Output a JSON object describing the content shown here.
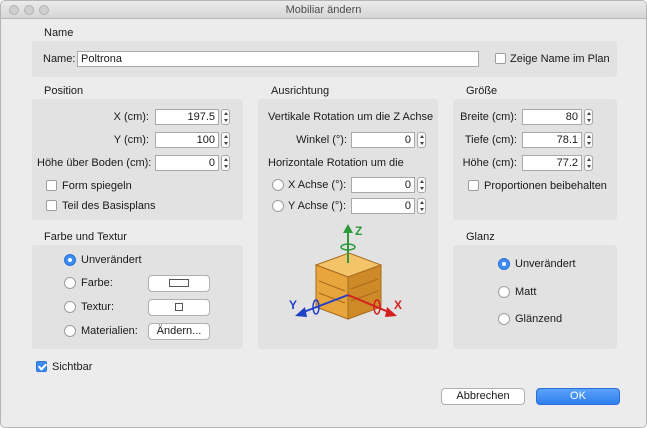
{
  "window": {
    "title": "Mobiliar ändern"
  },
  "name_section": {
    "title": "Name",
    "label": "Name:",
    "value": "Poltrona",
    "show_name_label": "Zeige Name im Plan",
    "show_name_checked": false
  },
  "position": {
    "title": "Position",
    "x_label": "X (cm):",
    "x_value": "197.5",
    "y_label": "Y (cm):",
    "y_value": "100",
    "elevation_label": "Höhe über Boden (cm):",
    "elevation_value": "0",
    "mirror_label": "Teil des Basisplans",
    "mirror_form_label": "Form spiegeln"
  },
  "orientation": {
    "title": "Ausrichtung",
    "vertical_label": "Vertikale Rotation um die Z Achse",
    "angle_label": "Winkel (°):",
    "angle_value": "0",
    "horizontal_label": "Horizontale Rotation um die",
    "x_axis_label": "X Achse (°):",
    "x_axis_value": "0",
    "y_axis_label": "Y Achse (°):",
    "y_axis_value": "0",
    "axis_letters": {
      "z": "Z",
      "x": "X",
      "y": "Y"
    }
  },
  "size": {
    "title": "Größe",
    "width_label": "Breite (cm):",
    "width_value": "80",
    "depth_label": "Tiefe (cm):",
    "depth_value": "78.1",
    "height_label": "Höhe (cm):",
    "height_value": "77.2",
    "keep_proportions_label": "Proportionen beibehalten"
  },
  "color": {
    "title": "Farbe und Textur",
    "unchanged_label": "Unverändert",
    "color_label": "Farbe:",
    "texture_label": "Textur:",
    "materials_label": "Materialien:",
    "modify_button": "Ändern..."
  },
  "shininess": {
    "title": "Glanz",
    "unchanged_label": "Unverändert",
    "matt_label": "Matt",
    "shiny_label": "Glänzend"
  },
  "visible": {
    "label": "Sichtbar",
    "checked": true
  },
  "buttons": {
    "cancel": "Abbrechen",
    "ok": "OK"
  },
  "colors": {
    "accent": "#3b8cf7",
    "axis_x": "#d42020",
    "axis_y": "#2040c8",
    "axis_z": "#2c9a3a",
    "wood": "#e8a53c"
  }
}
